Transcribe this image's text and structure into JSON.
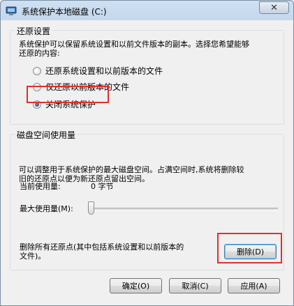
{
  "window": {
    "title": "系统保护本地磁盘 (C:)"
  },
  "restore_settings": {
    "legend": "还原设置",
    "description_line1": "系统保护可以保留系统设置和以前文件版本的副本。选择您希望能够",
    "description_line2": "还原的内容:",
    "options": [
      {
        "label": "还原系统设置和以前版本的文件",
        "checked": false
      },
      {
        "label": "仅还原以前版本的文件",
        "checked": false
      },
      {
        "label": "关闭系统保护",
        "checked": true
      }
    ]
  },
  "disk_usage": {
    "legend": "磁盘空间使用量",
    "description_line1": "可以调整用于系统保护的最大磁盘空间。占满空间时,系统将删除较",
    "description_line2": "旧的还原点以便为新还原点留出空间。",
    "current_label": "当前使用量:",
    "current_value": "0 字节",
    "max_label": "最大使用量(M):",
    "max_usage_fraction": 0,
    "delete_text_line1": "删除所有还原点(其中包括系统设置和以前版本的",
    "delete_text_line2": "文件)。",
    "delete_button": "删除(D)"
  },
  "buttons": {
    "ok": "确定(O)",
    "cancel": "取消(C)",
    "apply": "应用(A)"
  },
  "icons": {
    "app": "system-protection-icon",
    "close": "close-icon"
  }
}
